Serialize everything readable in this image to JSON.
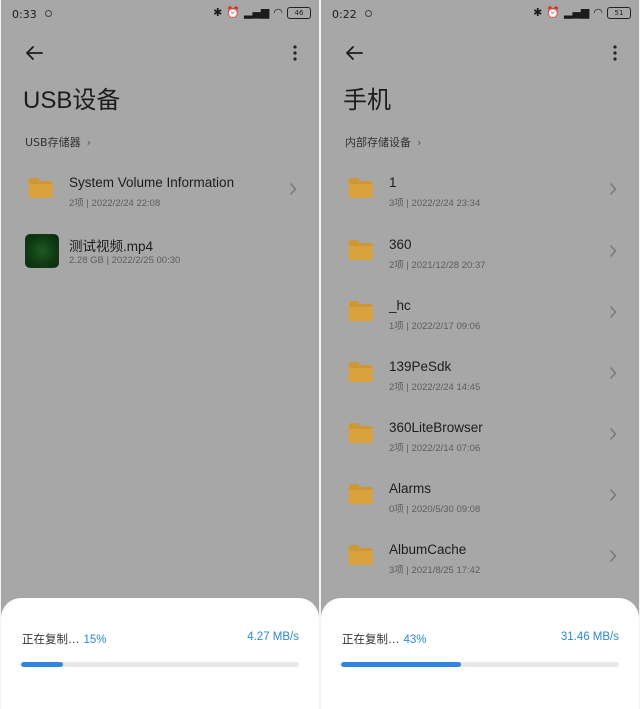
{
  "panels": [
    {
      "status": {
        "time": "0:33",
        "battery": "46"
      },
      "title": "USB设备",
      "breadcrumb": "USB存储器",
      "items": [
        {
          "type": "folder",
          "name": "System Volume Information",
          "count": "2项",
          "date": "2022/2/24 22:08"
        },
        {
          "type": "video",
          "name": "测试视频.mp4",
          "count": "2.28 GB",
          "date": "2022/2/25 00:30"
        }
      ],
      "copy": {
        "label": "正在复制…",
        "percent": "15%",
        "speed": "4.27 MB/s",
        "progress": 0.15
      }
    },
    {
      "status": {
        "time": "0:22",
        "battery": "51"
      },
      "title": "手机",
      "breadcrumb": "内部存储设备",
      "items": [
        {
          "type": "folder",
          "name": "1",
          "count": "3项",
          "date": "2022/2/24 23:34"
        },
        {
          "type": "folder",
          "name": "360",
          "count": "2项",
          "date": "2021/12/28 20:37"
        },
        {
          "type": "folder",
          "name": "_hc",
          "count": "1项",
          "date": "2022/2/17 09:06"
        },
        {
          "type": "folder",
          "name": "139PeSdk",
          "count": "2项",
          "date": "2022/2/24 14:45"
        },
        {
          "type": "folder",
          "name": "360LiteBrowser",
          "count": "2项",
          "date": "2022/2/14 07:06"
        },
        {
          "type": "folder",
          "name": "Alarms",
          "count": "0项",
          "date": "2020/5/30 09:08"
        },
        {
          "type": "folder",
          "name": "AlbumCache",
          "count": "3项",
          "date": "2021/8/25 17:42"
        }
      ],
      "copy": {
        "label": "正在复制…",
        "percent": "43%",
        "speed": "31.46 MB/s",
        "progress": 0.43
      }
    }
  ],
  "icons": {
    "back": "back-arrow-icon",
    "more": "more-vertical-icon",
    "folder": "folder-icon",
    "chevron": "chevron-right-icon",
    "bluetooth": "bluetooth-icon",
    "alarm": "alarm-icon",
    "signal": "signal-icon",
    "wifi": "wifi-icon"
  },
  "colors": {
    "accent": "#2e86e0",
    "folder": "#e0a43a",
    "dim_overlay": "#a7a7a7",
    "sheet": "#ffffff"
  }
}
